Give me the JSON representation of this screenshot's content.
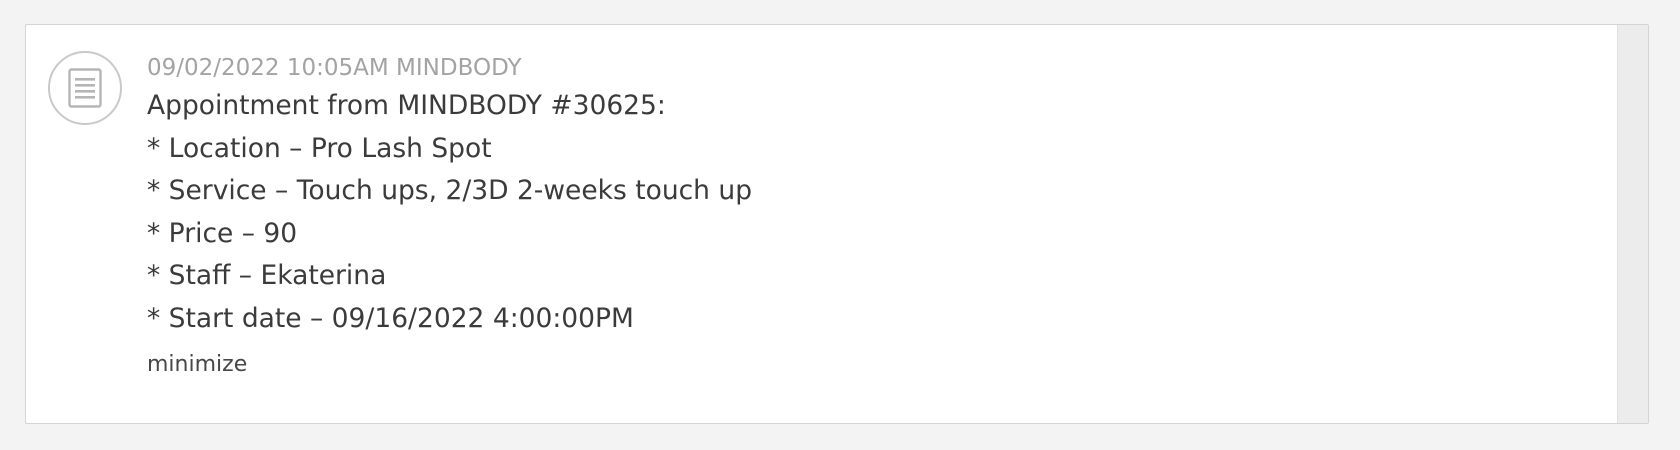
{
  "entry": {
    "icon": "document-icon",
    "meta": "09/02/2022 10:05AM MINDBODY",
    "lines": [
      "Appointment from MINDBODY #30625:",
      "* Location – Pro Lash Spot",
      "* Service – Touch ups, 2/3D 2-weeks touch up",
      "* Price – 90",
      "* Staff – Ekaterina",
      "* Start date – 09/16/2022 4:00:00PM"
    ],
    "minimize_label": "minimize"
  }
}
